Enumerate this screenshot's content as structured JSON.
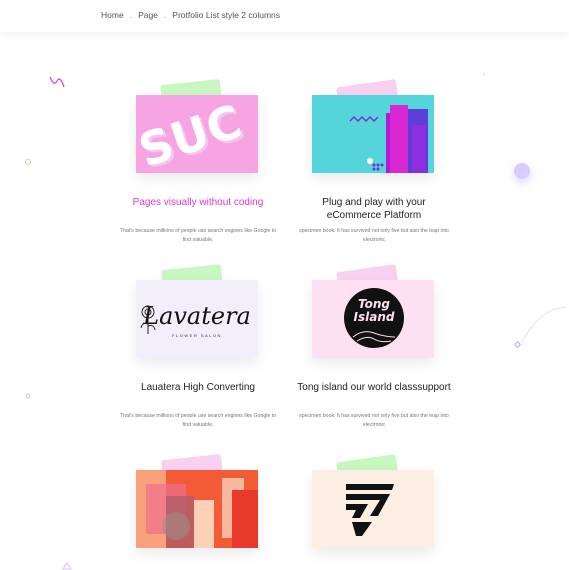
{
  "breadcrumb": {
    "home": "Home",
    "sep1": ".",
    "page": "Page",
    "sep2": ".",
    "current": "Protfolio List style 2 columns"
  },
  "cards": [
    {
      "title": "Pages visually without coding",
      "desc": "That's because millions of people use search engines like Google to find valuable,",
      "image": "pink-sus-3d-letters-image",
      "title_color": "#d43dd6"
    },
    {
      "title": "Plug and play with your eCommerce Platform",
      "desc": "specimen book. It has survived not only five but also the leap into electronic",
      "image": "cyan-purple-abstract-image",
      "title_color": "#222222"
    },
    {
      "title": "Lauatera High Converting",
      "desc": "That's because millions of people use search engines like Google to find valuable,",
      "image": "lavatera-logo-image",
      "logo_text": "Lavatera",
      "logo_sub": "FLOWER SALON",
      "title_color": "#222222"
    },
    {
      "title": "Tong island our world classsupport",
      "desc": "specimen book. It has survived not only five but also the leap into electronic",
      "image": "tong-island-logo-image",
      "logo_line1": "Tong",
      "logo_line2": "Island",
      "title_color": "#222222"
    },
    {
      "image": "orange-collage-image"
    },
    {
      "image": "stripe-logo-image"
    }
  ],
  "colors": {
    "accent_pink": "#d43dd6",
    "tile_green": "#c9f7c2",
    "tile_pink": "#f8d0f0",
    "cyan": "#4fd3d8",
    "lavender_orb": "#d9ccff"
  }
}
